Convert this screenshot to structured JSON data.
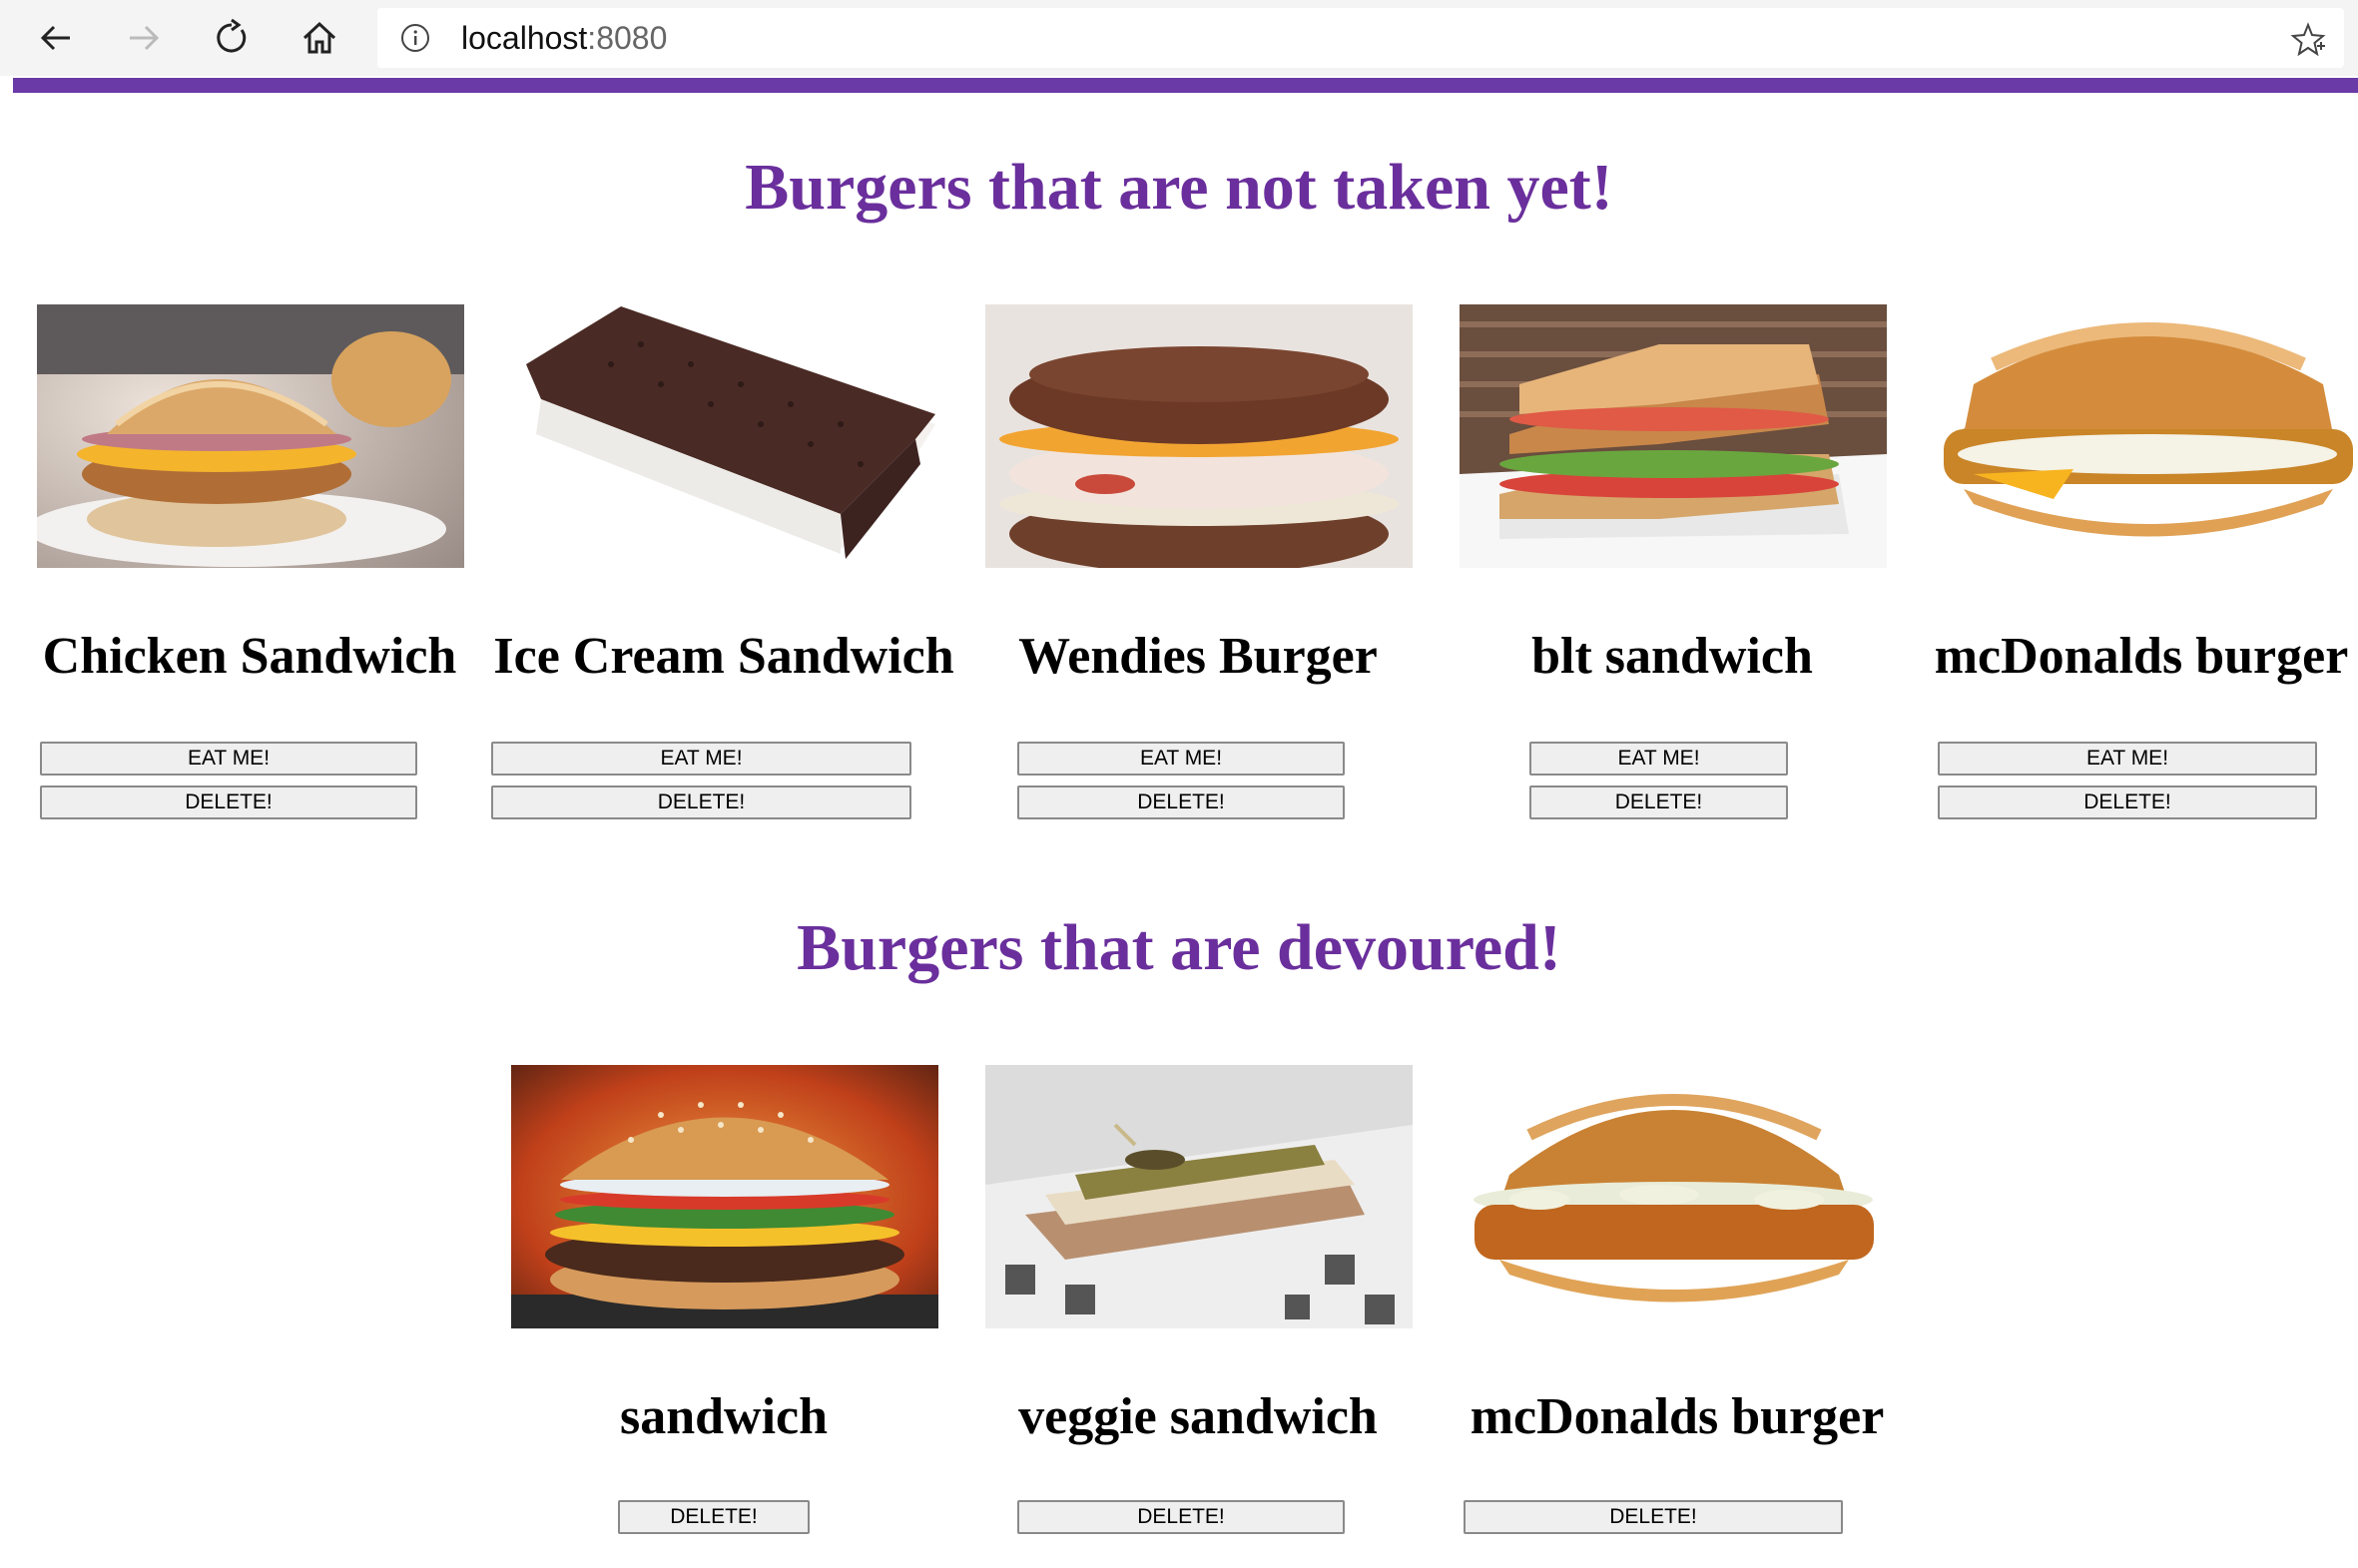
{
  "browser": {
    "url_host": "localhost",
    "url_port": ":8080"
  },
  "sections": {
    "available_title": "Burgers that are not taken yet!",
    "devoured_title": "Burgers that are devoured!"
  },
  "available": [
    {
      "name": "Chicken Sandwich",
      "eat_label": "EAT ME!",
      "delete_label": "DELETE!"
    },
    {
      "name": "Ice Cream Sandwich",
      "eat_label": "EAT ME!",
      "delete_label": "DELETE!"
    },
    {
      "name": "Wendies Burger",
      "eat_label": "EAT ME!",
      "delete_label": "DELETE!"
    },
    {
      "name": "blt sandwich",
      "eat_label": "EAT ME!",
      "delete_label": "DELETE!"
    },
    {
      "name": "mcDonalds burger",
      "eat_label": "EAT ME!",
      "delete_label": "DELETE!"
    }
  ],
  "devoured": [
    {
      "name": "sandwich",
      "delete_label": "DELETE!"
    },
    {
      "name": "veggie sandwich",
      "delete_label": "DELETE!"
    },
    {
      "name": "mcDonalds burger",
      "delete_label": "DELETE!"
    }
  ],
  "colors": {
    "accent": "#6a3aa6",
    "heading": "#6a2f9c"
  },
  "icons": [
    "back-arrow-icon",
    "forward-arrow-icon",
    "refresh-icon",
    "home-icon",
    "info-icon",
    "favorite-star-icon"
  ]
}
